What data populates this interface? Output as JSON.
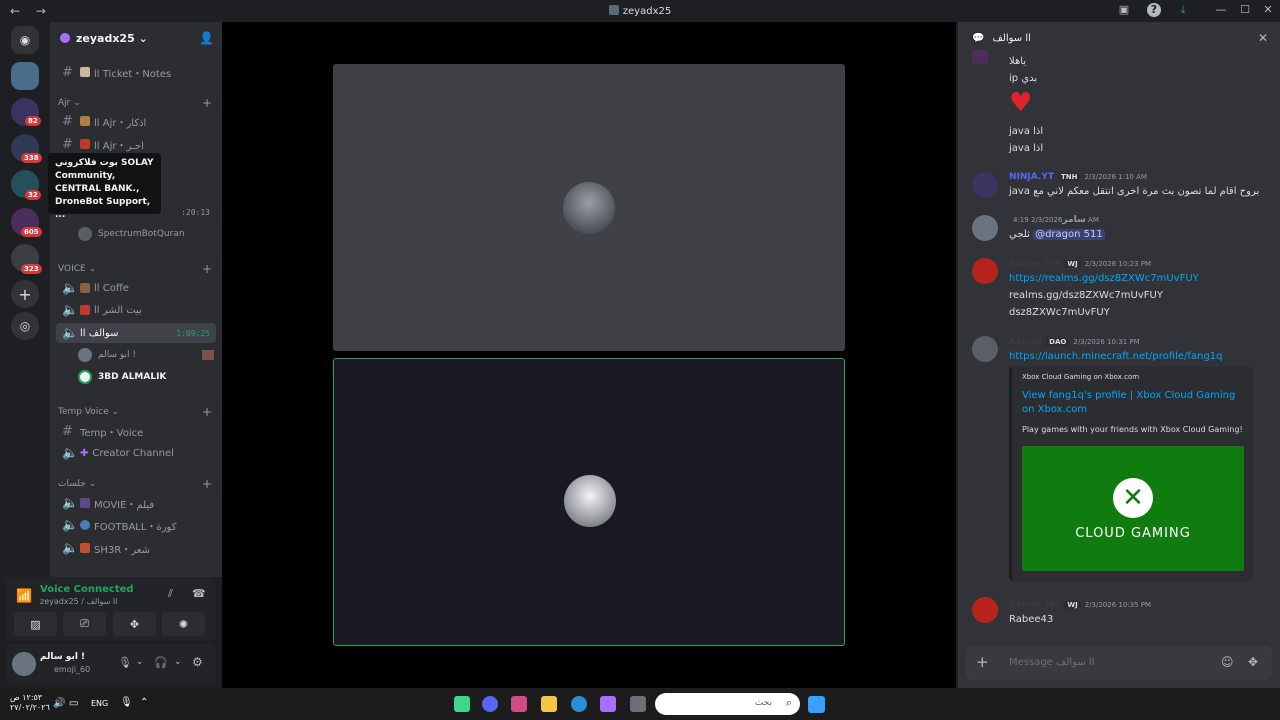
{
  "window": {
    "title": "zeyadx25"
  },
  "guilds": {
    "badges": [
      "82",
      "338",
      "32",
      "605",
      "323"
    ]
  },
  "server": {
    "name": "zeyadx25"
  },
  "channels": {
    "ticket": "ll Ticket・Notes",
    "cat_ajr": "Ajr",
    "ajr1": "ll Ajr・اذكار",
    "ajr2": "ll Ajr・اجـر",
    "hidden_time": ":20:13",
    "bot": "SpectrumBotQuran",
    "cat_voice": "VOICE",
    "voice1": "ll Coffe",
    "voice2": "ll بيت الشر",
    "voice3": "ll سوالف",
    "voice3_time": "1:09:25",
    "member1": "ابو سالم !",
    "member2": "3BD ALMALIK",
    "cat_temp": "Temp Voice",
    "temp1": "Temp・Voice",
    "temp2": "Creator Channel",
    "cat_sessions": "جلسات",
    "movie": "MOVIE・فيلم",
    "football": "FOOTBALL・كورة",
    "sh3r": "SH3R・شعر"
  },
  "tooltip": "بوت فلاكروني SOLAY Community, CENTRAL BANK., DroneBot Support, ...",
  "voice_panel": {
    "status": "Voice Connected",
    "channel": "zeyadx25 / سوالف ll"
  },
  "user_panel": {
    "name": "ابو سالم !",
    "status": "emoji_60"
  },
  "chat": {
    "title": "سوالف ll",
    "lines": {
      "l1": "ياهلا",
      "l2": "ip بدي",
      "l3": "java اذا",
      "l4": "java اذا"
    },
    "m1": {
      "name": "NINJA.YT",
      "tag": "TNH",
      "time": "2/3/2026 1:10 AM",
      "text": "java بروح اقام لما تصون بث مرة اخرى انتقل معكم لاني مع"
    },
    "m2": {
      "name": "سامر",
      "time": "2/3/2026 4:19 AM",
      "mention": "@dragon 511",
      "text": "ثلجي"
    },
    "m3": {
      "name": "Rabee_M4",
      "tag": "WJ",
      "time": "2/3/2026 10:23 PM",
      "link": "https://realms.gg/dsz8ZXWc7mUvFUY",
      "t2": "realms.gg/dsz8ZXWc7mUvFUY",
      "t3": "dsz8ZXWc7mUvFUY"
    },
    "m4": {
      "name": "Ashraf",
      "tag": "DAO",
      "time": "2/3/2026 10:31 PM",
      "link": "https://launch.minecraft.net/profile/fang1q"
    },
    "embed": {
      "provider": "Xbox Cloud Gaming on Xbox.com",
      "title": "View fang1q's profile | Xbox Cloud Gaming on Xbox.com",
      "desc": "Play games with your friends with Xbox Cloud Gaming!",
      "image_text": "CLOUD GAMING"
    },
    "m5": {
      "name": "Rabee_M4",
      "tag": "WJ",
      "time": "2/3/2026 10:35 PM",
      "text": "Rabee43"
    },
    "placeholder": "Message سوالف ll"
  },
  "taskbar": {
    "time": "١٢:٥٣ ص",
    "date": "٢٧/٠٢/٢٠٢٦",
    "lang": "ENG",
    "search": "بحث"
  }
}
